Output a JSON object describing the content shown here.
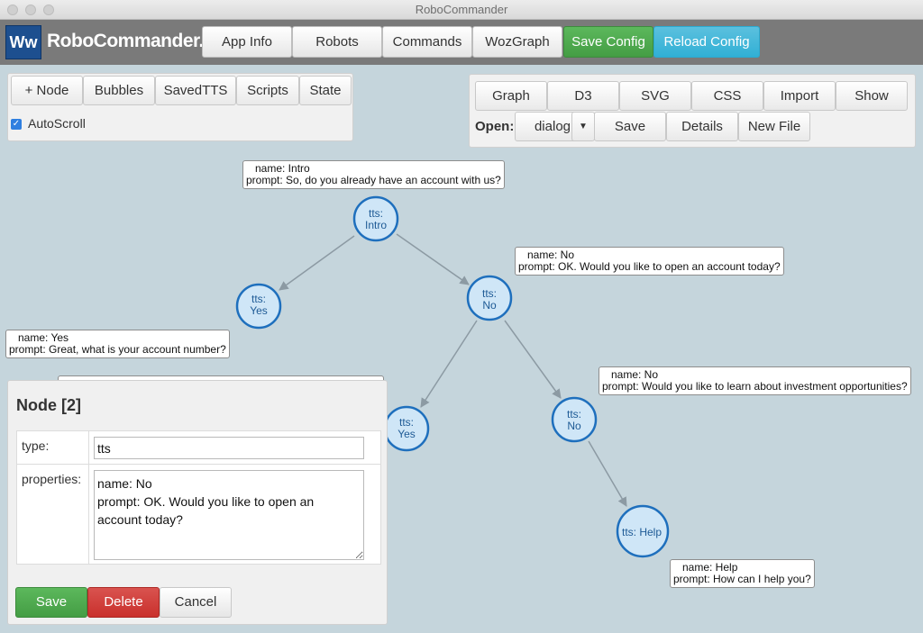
{
  "window": {
    "title": "RoboCommander"
  },
  "navbar": {
    "logo_text": "Ww",
    "brand": "RoboCommander.io",
    "items": [
      "App Info",
      "Robots",
      "Commands",
      "WozGraph"
    ],
    "save_config": "Save Config",
    "reload_config": "Reload Config"
  },
  "toolbar_left": {
    "buttons": [
      "+ Node",
      "Bubbles",
      "SavedTTS",
      "Scripts",
      "State"
    ],
    "autoscroll_label": "AutoScroll",
    "autoscroll_checked": true
  },
  "toolbar_right": {
    "buttons": [
      "Graph",
      "D3",
      "SVG",
      "CSS",
      "Import",
      "Show"
    ],
    "open_label": "Open:",
    "open_value": "dialog",
    "save": "Save",
    "details": "Details",
    "new_file": "New File"
  },
  "graph": {
    "nodes": [
      {
        "id": "intro",
        "line1": "tts:",
        "line2": "Intro"
      },
      {
        "id": "yes1",
        "line1": "tts:",
        "line2": "Yes"
      },
      {
        "id": "no1",
        "line1": "tts:",
        "line2": "No"
      },
      {
        "id": "yes2",
        "line1": "tts:",
        "line2": "Yes"
      },
      {
        "id": "no2",
        "line1": "tts:",
        "line2": "No"
      },
      {
        "id": "help",
        "line1": "tts: Help",
        "line2": ""
      }
    ],
    "bubbles": [
      {
        "name": "name: Intro",
        "prompt": "prompt: So, do you already have an account with us?"
      },
      {
        "name": "name: No",
        "prompt": "prompt: OK. Would you like to open an account today?"
      },
      {
        "name": "name: Yes",
        "prompt": "prompt: Great, what is your account number?"
      },
      {
        "name": "name: No",
        "prompt": "prompt: Would you like to learn about investment opportunities?"
      },
      {
        "name": "name: Help",
        "prompt": "prompt: How can I help you?"
      }
    ]
  },
  "editor": {
    "title": "Node [2]",
    "type_label": "type:",
    "type_value": "tts",
    "properties_label": "properties:",
    "properties_value": "name: No\nprompt: OK. Would you like to open an account today?",
    "save": "Save",
    "delete": "Delete",
    "cancel": "Cancel"
  },
  "colors": {
    "canvas_bg": "#c5d5dc",
    "navbar_bg": "#7a7a7a",
    "node_fill": "#cfe6f7",
    "node_stroke": "#1e6fbd",
    "save_config": "#5cb85c",
    "reload_config": "#5bc0de",
    "delete": "#d9534f"
  }
}
